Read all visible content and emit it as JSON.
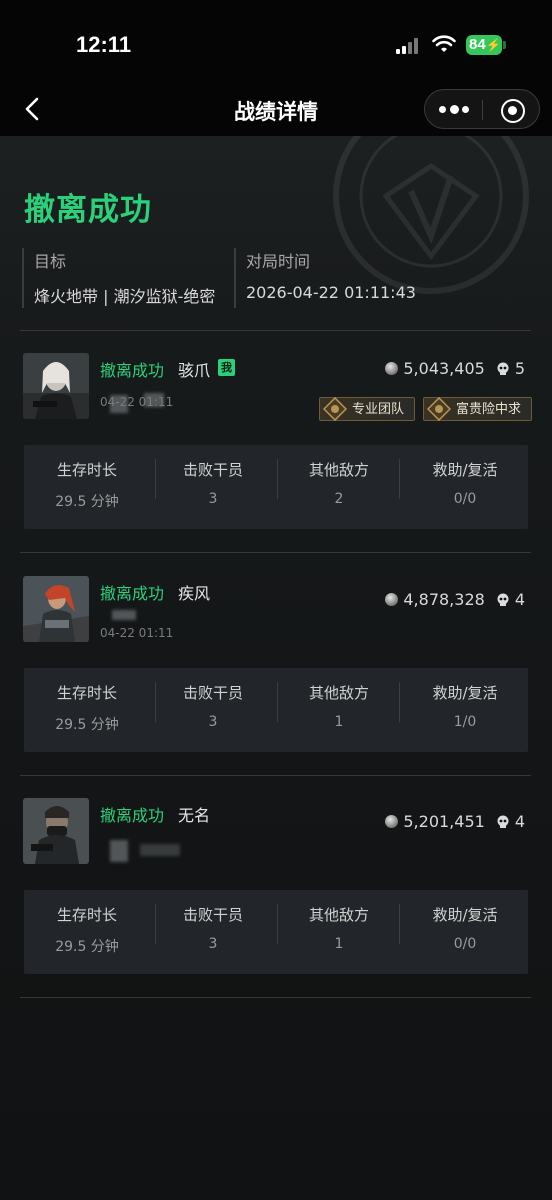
{
  "status_bar": {
    "time": "12:11",
    "battery": "84"
  },
  "nav": {
    "title": "战绩详情"
  },
  "match": {
    "result": "撤离成功",
    "target_label": "目标",
    "target_value": "烽火地带 | 潮汐监狱-绝密",
    "time_label": "对局时间",
    "time_value": "2026-04-22 01:11:43"
  },
  "stat_labels": [
    "生存时长",
    "击败干员",
    "其他敌方",
    "救助/复活"
  ],
  "players": [
    {
      "status": "撤离成功",
      "name": "骇爪",
      "me_badge": "我",
      "sub_time": "04-22 01:11",
      "money": "5,043,405",
      "kills": "5",
      "tags": [
        "专业团队",
        "富贵险中求"
      ],
      "stats": [
        "29.5 分钟",
        "3",
        "2",
        "0/0"
      ]
    },
    {
      "status": "撤离成功",
      "name": "疾风",
      "sub_time": "04-22 01:11",
      "money": "4,878,328",
      "kills": "4",
      "stats": [
        "29.5 分钟",
        "3",
        "1",
        "1/0"
      ]
    },
    {
      "status": "撤离成功",
      "name": "无名",
      "money": "5,201,451",
      "kills": "4",
      "stats": [
        "29.5 分钟",
        "3",
        "1",
        "0/0"
      ]
    }
  ],
  "colors": {
    "success": "#2ad07a",
    "background": "#121314",
    "card": "#22262a",
    "tag_border": "#6c5b34"
  },
  "icons": [
    "back-arrow-icon",
    "more-dots-icon",
    "target-icon",
    "coin-icon",
    "skull-icon",
    "medal-icon",
    "signal-icon",
    "wifi-icon",
    "battery-icon"
  ]
}
